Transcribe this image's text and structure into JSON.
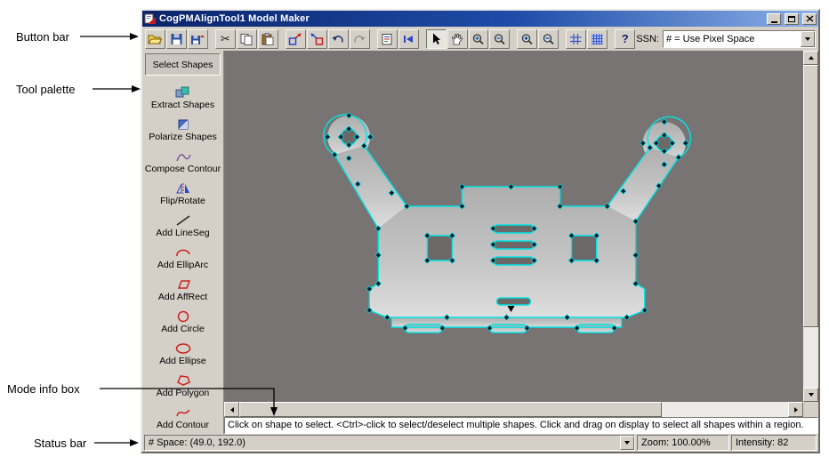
{
  "annotations": {
    "button_bar": "Button bar",
    "tool_palette": "Tool palette",
    "mode_info_box": "Mode info box",
    "status_bar": "Status bar"
  },
  "window": {
    "title": "CogPMAlignTool1 Model Maker"
  },
  "toolbar": {
    "ssn_label": "SSN:",
    "ssn_value": "# = Use Pixel Space",
    "buttons": [
      "open",
      "save",
      "save-image",
      "cut",
      "copy",
      "paste",
      "pattern-tool-a",
      "pattern-tool-b",
      "undo",
      "redo",
      "properties",
      "run",
      "select-pointer",
      "pan-hand",
      "zoom-in",
      "zoom-out",
      "zoom-expand",
      "zoom-shrink",
      "grid",
      "grid-snap",
      "help"
    ]
  },
  "icons": {
    "cut": "✂",
    "help": "?"
  },
  "palette": {
    "items": [
      {
        "label": "Select Shapes"
      },
      {
        "label": "Extract Shapes"
      },
      {
        "label": "Polarize Shapes"
      },
      {
        "label": "Compose Contour"
      },
      {
        "label": "Flip/Rotate"
      },
      {
        "label": "Add LineSeg"
      },
      {
        "label": "Add EllipArc"
      },
      {
        "label": "Add AffRect"
      },
      {
        "label": "Add Circle"
      },
      {
        "label": "Add Ellipse"
      },
      {
        "label": "Add Polygon"
      },
      {
        "label": "Add Contour"
      }
    ]
  },
  "mode_info": "Click on shape to select. <Ctrl>-click to select/deselect multiple shapes. Click and drag on display to select all shapes within a region.",
  "status": {
    "space": "# Space:  (49.0, 192.0)",
    "zoom": "Zoom:  100.00%",
    "intensity": "Intensity:  82"
  },
  "colors": {
    "contour": "#00e4e4",
    "titlebar_start": "#0a246a",
    "titlebar_end": "#8cb0e8",
    "chrome": "#d4d0c8"
  }
}
